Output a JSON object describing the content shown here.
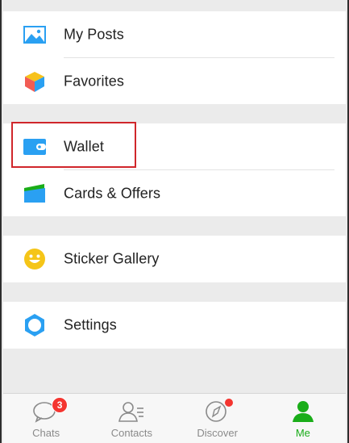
{
  "menu": {
    "group1": [
      {
        "label": "My Posts",
        "icon": "photo-album-icon"
      },
      {
        "label": "Favorites",
        "icon": "cube-icon"
      }
    ],
    "group2": [
      {
        "label": "Wallet",
        "icon": "wallet-icon"
      },
      {
        "label": "Cards & Offers",
        "icon": "card-icon"
      }
    ],
    "group3": [
      {
        "label": "Sticker Gallery",
        "icon": "smiley-icon"
      }
    ],
    "group4": [
      {
        "label": "Settings",
        "icon": "gear-icon"
      }
    ]
  },
  "tabbar": {
    "tabs": [
      {
        "label": "Chats",
        "icon": "chat-bubble-icon",
        "badge": "3"
      },
      {
        "label": "Contacts",
        "icon": "contacts-icon"
      },
      {
        "label": "Discover",
        "icon": "compass-icon"
      },
      {
        "label": "Me",
        "icon": "person-icon",
        "active": true
      }
    ]
  },
  "colors": {
    "accent_green": "#1aad19",
    "badge_red": "#f43530",
    "highlight_red": "#d0262b",
    "icon_blue": "#2aa0f2"
  }
}
